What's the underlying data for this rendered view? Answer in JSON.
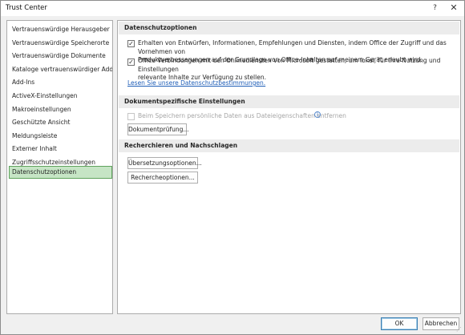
{
  "window": {
    "title": "Trust Center",
    "help_glyph": "?",
    "close_glyph": "✕"
  },
  "sidebar": {
    "items": [
      {
        "label": "Vertrauenswürdige Herausgeber"
      },
      {
        "label": "Vertrauenswürdige Speicherorte"
      },
      {
        "label": "Vertrauenswürdige Dokumente"
      },
      {
        "label": "Kataloge vertrauenswürdiger Add-Ins"
      },
      {
        "label": "Add-Ins"
      },
      {
        "label": "ActiveX-Einstellungen"
      },
      {
        "label": "Makroeinstellungen"
      },
      {
        "label": "Geschützte Ansicht"
      },
      {
        "label": "Meldungsleiste"
      },
      {
        "label": "Externer Inhalt"
      },
      {
        "label": "Zugriffsschutzeinstellungen"
      },
      {
        "label": "Datenschutzoptionen"
      }
    ],
    "selected": "Datenschutzoptionen"
  },
  "main": {
    "privacy": {
      "header": "Datenschutzoptionen",
      "option1": {
        "checked": true,
        "line1": "Erhalten von Entwürfen, Informationen, Empfehlungen und Diensten, indem Office der Zugriff und das Vornehmen von",
        "line2": "Produktverbesserungen auf der Grundlage von Office-Inhalten auf meinem Gerät erlaubt wird."
      },
      "option2": {
        "checked": true,
        "line1": "Office Verbindungen mit den Onlinediensten von Microsoft gestatten, um lokal, für Ihre Nutzung und Einstellungen",
        "line2": "relevante Inhalte zur Verfügung zu stellen."
      },
      "link": "Lesen Sie unsere Datenschutzbestimmungen."
    },
    "document": {
      "header": "Dokumentspezifische Einstellungen",
      "option": {
        "checked": false,
        "enabled": false,
        "label": "Beim Speichern persönliche Daten aus Dateieigenschaften entfernen"
      },
      "info_glyph": "i",
      "inspect_button": "Dokumentprüfung..."
    },
    "research": {
      "header": "Recherchieren und Nachschlagen",
      "translation_button": "Übersetzungsoptionen...",
      "research_button": "Rechercheoptionen..."
    }
  },
  "footer": {
    "ok_label": "OK",
    "cancel_label": "Abbrechen",
    "grip_glyph": "⋰"
  },
  "check_glyph": "✓",
  "colors": {
    "selected_bg": "#c6e5c5",
    "selected_border": "#5fa35c",
    "link": "#1f5eb7",
    "section_bg": "#ececec"
  }
}
